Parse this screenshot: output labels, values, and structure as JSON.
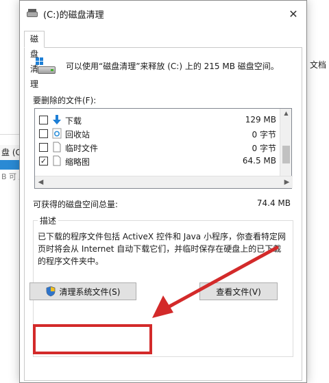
{
  "background": {
    "left_item_label": "盘 (C",
    "left_item_sub": "B 可 /",
    "right_text": "文档"
  },
  "dialog": {
    "title": "(C:)的磁盘清理",
    "close_glyph": "✕",
    "tab_label": "磁盘清理",
    "summary": "可以使用“磁盘清理”来释放 (C:) 上的 215 MB 磁盘空间。",
    "files_label": "要删除的文件(F):",
    "files": [
      {
        "name": "下载",
        "size": "129 MB",
        "checked": false,
        "icon": "download-arrow-icon"
      },
      {
        "name": "回收站",
        "size": "0 字节",
        "checked": false,
        "icon": "recycle-bin-icon"
      },
      {
        "name": "临时文件",
        "size": "0 字节",
        "checked": false,
        "icon": "blank-file-icon"
      },
      {
        "name": "缩略图",
        "size": "64.5 MB",
        "checked": true,
        "icon": "blank-file-icon"
      }
    ],
    "available_label": "可获得的磁盘空间总量:",
    "available_value": "74.4 MB",
    "description_title": "描述",
    "description_text": "已下载的程序文件包括 ActiveX 控件和 Java 小程序，你查看特定网页时将会从 Internet 自动下载它们，并临时保存在硬盘上的已下载的程序文件夹中。",
    "clean_system_button": "清理系统文件(S)",
    "view_files_button": "查看文件(V)",
    "check_glyph": "✓"
  },
  "colors": {
    "annotation_red": "#d32a2a",
    "accent_blue": "#1e7fd6"
  }
}
